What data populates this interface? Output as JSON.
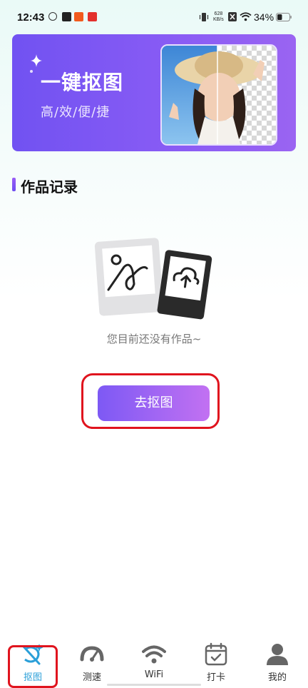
{
  "status_bar": {
    "time": "12:43",
    "net_speed": "628",
    "net_unit": "KB/s",
    "battery": "34%"
  },
  "banner": {
    "title": "一键抠图",
    "subtitle": "高/效/便/捷"
  },
  "section": {
    "title": "作品记录"
  },
  "empty_state": {
    "message": "您目前还没有作品~",
    "button_label": "去抠图"
  },
  "bottom_nav": {
    "items": [
      {
        "label": "抠图",
        "icon": "cutout-icon",
        "active": true
      },
      {
        "label": "测速",
        "icon": "speedometer-icon",
        "active": false
      },
      {
        "label": "WiFi",
        "icon": "wifi-icon",
        "active": false
      },
      {
        "label": "打卡",
        "icon": "calendar-check-icon",
        "active": false
      },
      {
        "label": "我的",
        "icon": "profile-icon",
        "active": false
      }
    ]
  },
  "colors": {
    "accent": "#7152f2",
    "active_tab": "#2a9fd8",
    "annotation": "#e0141e"
  }
}
